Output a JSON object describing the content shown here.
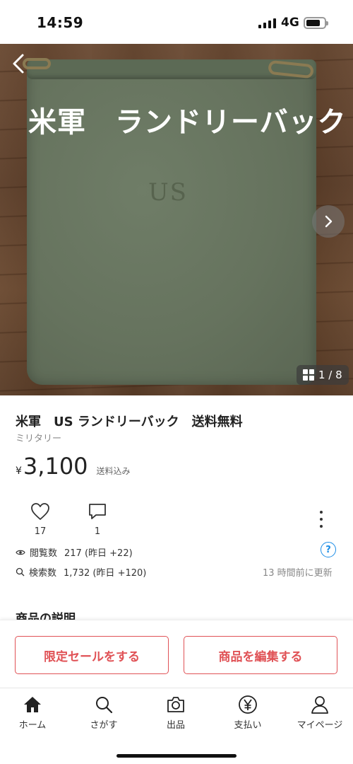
{
  "status_bar": {
    "time": "14:59",
    "network": "4G"
  },
  "hero": {
    "caption": "米軍　ランドリーバック",
    "bag_print": "US",
    "photo_counter": "1 / 8"
  },
  "product": {
    "title": "米軍　US ランドリーバック　送料無料",
    "category": "ミリタリー",
    "currency_symbol": "¥",
    "price": "3,100",
    "shipping_note": "送料込み"
  },
  "stats": {
    "likes": "17",
    "comments": "1"
  },
  "meta": {
    "views_label": "閲覧数",
    "views_value": "217 (昨日 +22)",
    "search_label": "検索数",
    "search_value": "1,732 (昨日 +120)",
    "updated": "13 時間前に更新",
    "help": "?"
  },
  "description_heading": "商品の説明",
  "actions": {
    "limited_sale": "限定セールをする",
    "edit_item": "商品を編集する"
  },
  "tabs": [
    {
      "label": "ホーム",
      "icon": "home-icon"
    },
    {
      "label": "さがす",
      "icon": "search-icon"
    },
    {
      "label": "出品",
      "icon": "camera-icon"
    },
    {
      "label": "支払い",
      "icon": "yen-icon"
    },
    {
      "label": "マイページ",
      "icon": "person-icon"
    }
  ],
  "colors": {
    "accent": "#e05256",
    "link": "#1a8ce6"
  }
}
